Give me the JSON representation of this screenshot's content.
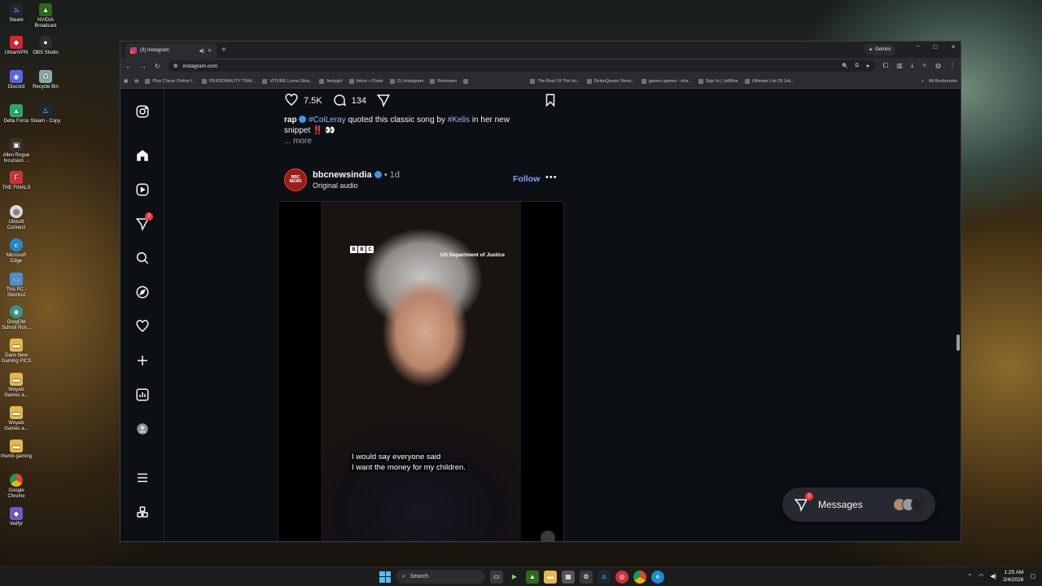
{
  "desktop": {
    "icons": [
      "Steam",
      "NVIDIA Broadcast",
      "UrbanVPN",
      "OBS Studio",
      "Discord",
      "Recycle Bin",
      "Delta Force",
      "Steam - Copy",
      "Allen Rogue Incursion ...",
      "THE FINALS",
      "Ubisoft Connect",
      "Microsoft Edge",
      "This PC - Shortcut",
      "GregOld School Run...",
      "Dans New Gaming PICS",
      "Woyals Games a...",
      "Woyals Games a...",
      "thumb gaming",
      "Google Chrome",
      "Veilfyr"
    ]
  },
  "browser": {
    "tab_title": "(3) Instagram",
    "new_tab": "+",
    "gemini_label": "Gemini",
    "url": "instagram.com",
    "bookmarks": [
      "Play Chess Online f...",
      "PERSONALITY TRAI...",
      "VITURE Luma Ultra...",
      "feetygirl",
      "Inbox • Chats",
      "(1) Instagram",
      "Restream"
    ],
    "bookmarks_right": [
      "The Best Of The Int...",
      "DelenQueen Strea...",
      "games games - sha...",
      "Sign In | JetBlue",
      "Ultimate List Of Jok..."
    ],
    "all_bookmarks": "All Bookmarks"
  },
  "nav": {
    "notif_count": "3"
  },
  "post_prev": {
    "likes": "7.5K",
    "comments": "134",
    "caption_user": "rap",
    "caption_tag1": "#CoiLeray",
    "caption_mid": " quoted this classic song by ",
    "caption_tag2": "#Kelis",
    "caption_end": " in her new snippet ‼️ 👀",
    "more": "... more"
  },
  "post": {
    "username": "bbcnewsindia",
    "age": "1d",
    "audio": "Original audio",
    "follow": "Follow",
    "avatar_text": "BBC NEWS",
    "bbc_letters": [
      "B",
      "B",
      "C"
    ],
    "watermark": "US Department of Justice",
    "subtitle_line1": "I would say everyone said",
    "subtitle_line2": "I want the money for my children."
  },
  "messages": {
    "label": "Messages",
    "count": "3"
  },
  "taskbar": {
    "search": "Search",
    "time": "1:25 AM",
    "date": "2/4/2026"
  },
  "colors": {
    "accent_link": "#85a1ff",
    "notif_red": "#ff3040",
    "tag_blue": "#a0b4ff"
  }
}
